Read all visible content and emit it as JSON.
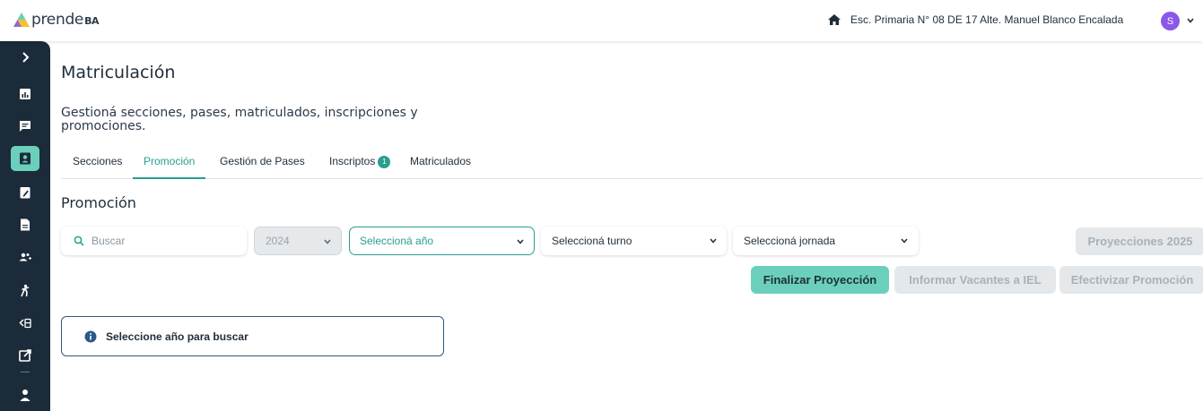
{
  "header": {
    "logo_text": "prende",
    "logo_suffix": "BA",
    "school_name": "Esc. Primaria N° 08 DE 17 Alte. Manuel Blanco Encalada",
    "avatar_initial": "S"
  },
  "sidebar": {
    "items": [
      {
        "icon": "chevron-right-icon"
      },
      {
        "icon": "bar-chart-icon"
      },
      {
        "icon": "chat-icon"
      },
      {
        "icon": "id-badge-icon",
        "active": true
      },
      {
        "icon": "clipboard-edit-icon"
      },
      {
        "icon": "document-icon"
      },
      {
        "icon": "people-icon"
      },
      {
        "icon": "person-walk-icon"
      },
      {
        "icon": "transfer-icon"
      },
      {
        "icon": "external-link-icon"
      },
      {
        "icon": "user-icon"
      }
    ]
  },
  "page": {
    "title": "Matriculación",
    "description": "Gestioná secciones, pases, matriculados, inscripciones y promociones."
  },
  "tabs": [
    {
      "label": "Secciones"
    },
    {
      "label": "Promoción",
      "active": true
    },
    {
      "label": "Gestión de Pases"
    },
    {
      "label": "Inscriptos",
      "badge": "1"
    },
    {
      "label": "Matriculados"
    }
  ],
  "section": {
    "title": "Promoción"
  },
  "filters": {
    "search_placeholder": "Buscar",
    "year_value": "2024",
    "anio_placeholder": "Seleccioná año",
    "turno_placeholder": "Seleccioná turno",
    "jornada_placeholder": "Seleccioná jornada"
  },
  "buttons": {
    "proyecciones": "Proyecciones 2025",
    "finalizar": "Finalizar Proyección",
    "informar": "Informar Vacantes a IEL",
    "efectivizar": "Efectivizar Promoción"
  },
  "info": {
    "message": "Seleccione año para buscar"
  },
  "colors": {
    "accent": "#2a9d8f",
    "accent_light": "#6ad0bc",
    "sidebar_bg": "#1c2b3a",
    "avatar_bg": "#8a57e8",
    "info_icon": "#2a5a8a"
  }
}
